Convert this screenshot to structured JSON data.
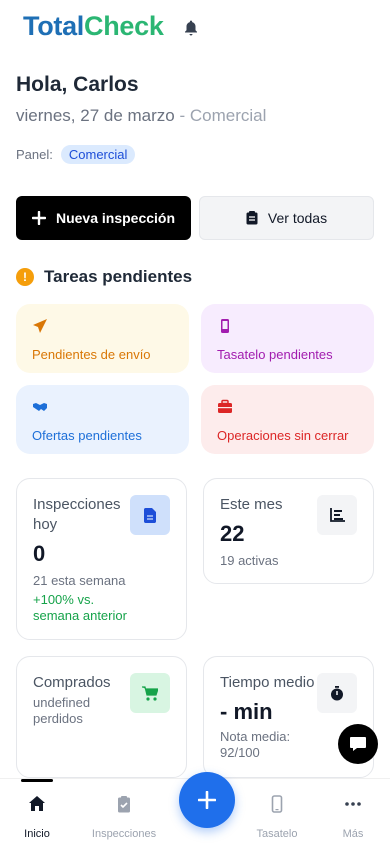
{
  "brand": {
    "part1": "Total",
    "part2": "Check"
  },
  "greeting": "Hola, Carlos",
  "date": "viernes, 27 de marzo",
  "role": " - Comercial",
  "panel": {
    "label": "Panel:",
    "value": "Comercial"
  },
  "actions": {
    "new_inspection": "Nueva inspección",
    "see_all": "Ver todas"
  },
  "tasks": {
    "title": "Tareas pendientes",
    "items": [
      {
        "label": "Pendientes de envío",
        "icon": "paper-plane-icon",
        "color": "#d97706"
      },
      {
        "label": "Tasatelo pendientes",
        "icon": "mobile-icon",
        "color": "#a21caf"
      },
      {
        "label": "Ofertas pendientes",
        "icon": "handshake-icon",
        "color": "#1d6fd8"
      },
      {
        "label": "Operaciones sin cerrar",
        "icon": "briefcase-icon",
        "color": "#dc2626"
      }
    ]
  },
  "stats": {
    "inspections_today": {
      "caption": "Inspecciones hoy",
      "value": "0",
      "sub": "21 esta semana",
      "trend": "+100% vs. semana anterior",
      "icon": "document-icon"
    },
    "this_month": {
      "caption": "Este mes",
      "value": "22",
      "sub": "19 activas",
      "icon": "bar-chart-icon"
    },
    "bought": {
      "caption": "Comprados",
      "sub": "undefined perdidos",
      "icon": "cart-icon"
    },
    "avg_time": {
      "caption": "Tiempo medio",
      "value": "- min",
      "sub": "Nota media: 92/100",
      "icon": "stopwatch-icon"
    }
  },
  "tabbar": {
    "items": [
      {
        "label": "Inicio",
        "icon": "home-icon",
        "active": true
      },
      {
        "label": "Inspecciones",
        "icon": "clipboard-icon",
        "active": false
      },
      {
        "label": "Tasatelo",
        "icon": "mobile-icon",
        "active": false
      },
      {
        "label": "Más",
        "icon": "more-icon",
        "active": false
      }
    ]
  },
  "colors": {
    "primary": "#1f6feb",
    "brand_blue": "#1e6fb5",
    "brand_green": "#2bb673"
  }
}
